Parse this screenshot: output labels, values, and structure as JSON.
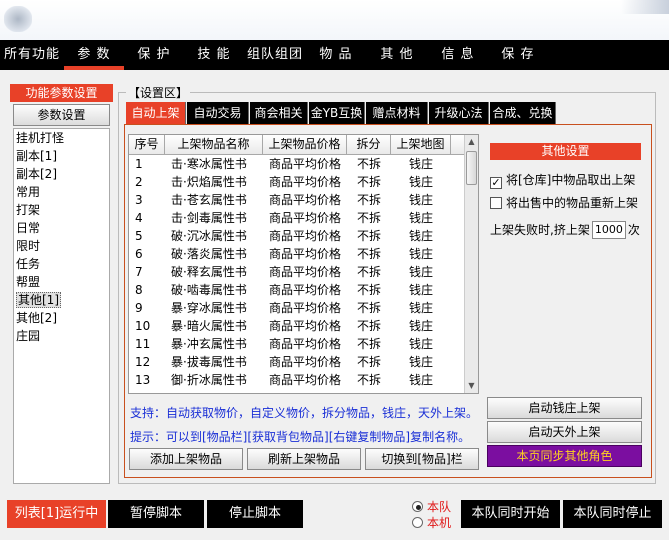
{
  "menu": [
    "所有功能",
    "参 数",
    "保 护",
    "技 能",
    "组队组团",
    "物 品",
    "其 他",
    "信 息",
    "保 存"
  ],
  "left": {
    "header": "功能参数设置",
    "button": "参数设置",
    "items": [
      "挂机打怪",
      "副本[1]",
      "副本[2]",
      "常用",
      "打架",
      "日常",
      "限时",
      "任务",
      "帮盟",
      "其他[1]",
      "其他[2]",
      "庄园"
    ],
    "selected_index": 9
  },
  "settings_label": "【设置区】",
  "tabs": [
    "自动上架",
    "自动交易",
    "商会相关",
    "金YB互换",
    "赠点材料",
    "升级心法",
    "合成、兑换"
  ],
  "active_tab": 0,
  "table": {
    "headers": [
      "序号",
      "上架物品名称",
      "上架物品价格",
      "拆分",
      "上架地图"
    ],
    "rows": [
      [
        "1",
        "击·寒冰属性书",
        "商品平均价格",
        "不拆",
        "钱庄"
      ],
      [
        "2",
        "击·炽焰属性书",
        "商品平均价格",
        "不拆",
        "钱庄"
      ],
      [
        "3",
        "击·苍玄属性书",
        "商品平均价格",
        "不拆",
        "钱庄"
      ],
      [
        "4",
        "击·剑毒属性书",
        "商品平均价格",
        "不拆",
        "钱庄"
      ],
      [
        "5",
        "破·沉冰属性书",
        "商品平均价格",
        "不拆",
        "钱庄"
      ],
      [
        "6",
        "破·落炎属性书",
        "商品平均价格",
        "不拆",
        "钱庄"
      ],
      [
        "7",
        "破·释玄属性书",
        "商品平均价格",
        "不拆",
        "钱庄"
      ],
      [
        "8",
        "破·啮毒属性书",
        "商品平均价格",
        "不拆",
        "钱庄"
      ],
      [
        "9",
        "暴·穿冰属性书",
        "商品平均价格",
        "不拆",
        "钱庄"
      ],
      [
        "10",
        "暴·暗火属性书",
        "商品平均价格",
        "不拆",
        "钱庄"
      ],
      [
        "11",
        "暴·冲玄属性书",
        "商品平均价格",
        "不拆",
        "钱庄"
      ],
      [
        "12",
        "暴·拔毒属性书",
        "商品平均价格",
        "不拆",
        "钱庄"
      ],
      [
        "13",
        "御·折冰属性书",
        "商品平均价格",
        "不拆",
        "钱庄"
      ]
    ]
  },
  "info_lines": [
    "支持：自动获取物价，自定义物价，拆分物品，钱庄，天外上架。",
    "提示：可以到[物品栏][获取背包物品][右键复制物品]复制名称。"
  ],
  "table_buttons": [
    "添加上架物品",
    "刷新上架物品",
    "切换到[物品]栏"
  ],
  "other": {
    "header": "其他设置",
    "checkbox1": {
      "label": "将[仓库]中物品取出上架",
      "checked": true
    },
    "checkbox2": {
      "label": "将出售中的物品重新上架",
      "checked": false
    },
    "retry_prefix": "上架失败时,挤上架",
    "retry_value": "1000",
    "retry_suffix": "次",
    "btn_qianzhuang": "启动钱庄上架",
    "btn_tianwai": "启动天外上架",
    "btn_sync": "本页同步其他角色"
  },
  "bottom": {
    "run_status": "列表[1]运行中",
    "pause": "暂停脚本",
    "stop": "停止脚本",
    "radio1": "本队",
    "radio2": "本机",
    "radio_selected": 0,
    "start_all": "本队同时开始",
    "stop_all": "本队同时停止"
  },
  "colors": {
    "accent": "#e84128",
    "menu_bg": "#000000",
    "info_text": "#1a2fd6",
    "sync_bg": "#7b0ea0",
    "sync_text": "#ffd21f"
  }
}
